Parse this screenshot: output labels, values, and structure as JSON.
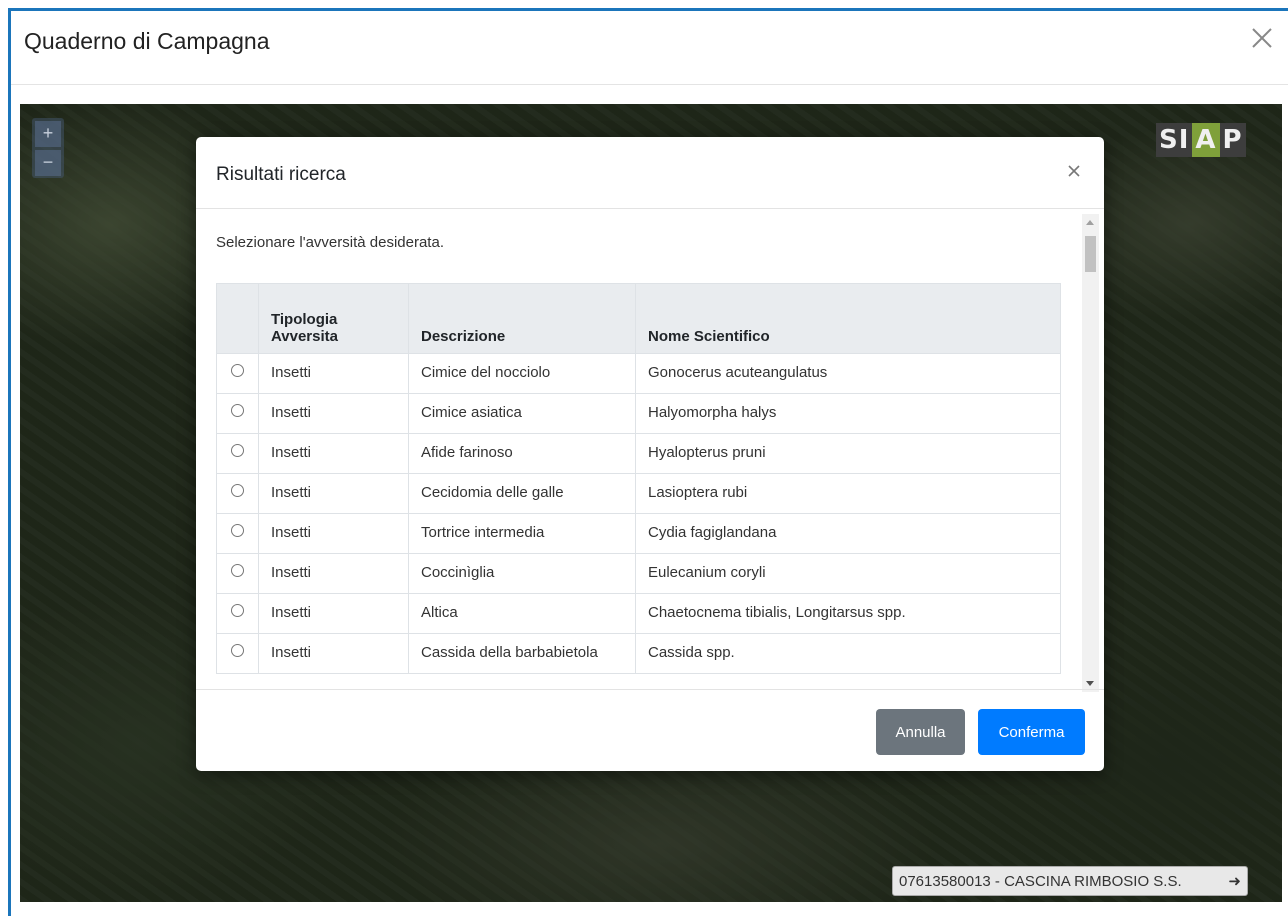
{
  "window": {
    "title": "Quaderno di Campagna",
    "close_icon": "close-icon"
  },
  "map": {
    "zoom_in": "+",
    "zoom_out": "−",
    "logo_text": "SIAP",
    "farm_label": "07613580013 - CASCINA RIMBOSIO S.S.",
    "farm_arrow": "➜"
  },
  "modal": {
    "title": "Risultati ricerca",
    "close_glyph": "×",
    "instructions": "Selezionare l'avversità desiderata.",
    "table": {
      "headers": [
        "",
        "Tipologia Avversita",
        "Descrizione",
        "Nome Scientifico"
      ],
      "rows": [
        {
          "tipologia": "Insetti",
          "descrizione": "Cimice del nocciolo",
          "nome": "Gonocerus acuteangulatus"
        },
        {
          "tipologia": "Insetti",
          "descrizione": "Cimice asiatica",
          "nome": "Halyomorpha halys"
        },
        {
          "tipologia": "Insetti",
          "descrizione": "Afide farinoso",
          "nome": "Hyalopterus pruni"
        },
        {
          "tipologia": "Insetti",
          "descrizione": "Cecidomia delle galle",
          "nome": "Lasioptera rubi"
        },
        {
          "tipologia": "Insetti",
          "descrizione": "Tortrice intermedia",
          "nome": "Cydia fagiglandana"
        },
        {
          "tipologia": "Insetti",
          "descrizione": "Coccinìglia",
          "nome": "Eulecanium coryli"
        },
        {
          "tipologia": "Insetti",
          "descrizione": "Altica",
          "nome": "Chaetocnema tibialis, Longitarsus spp."
        },
        {
          "tipologia": "Insetti",
          "descrizione": "Cassida della barbabietola",
          "nome": "Cassida spp."
        }
      ]
    },
    "buttons": {
      "cancel": "Annulla",
      "confirm": "Conferma"
    }
  },
  "colors": {
    "frame_border": "#1b75bb",
    "primary": "#007bff",
    "secondary": "#6c757d",
    "header_bg": "#e9ecef"
  }
}
